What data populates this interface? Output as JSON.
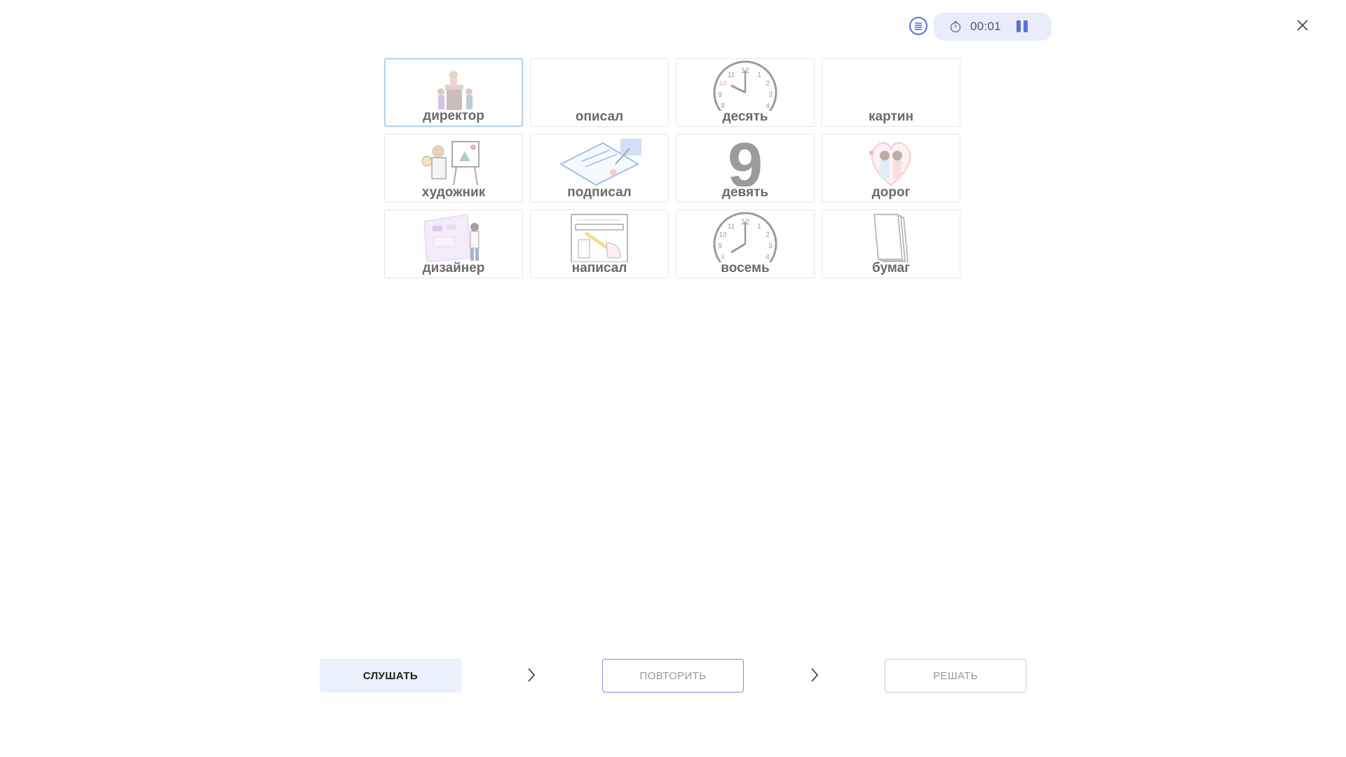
{
  "topbar": {
    "menu_icon": "list-icon",
    "timer_icon": "stopwatch-icon",
    "time": "00:01",
    "pause_icon": "pause-icon",
    "close_icon": "close-icon",
    "accent_color": "#5c6fd6"
  },
  "cards": [
    {
      "label": "директор",
      "picture": "people-on-books-illustration",
      "selected": true
    },
    {
      "label": "описал",
      "picture": "",
      "selected": false
    },
    {
      "label": "десять",
      "picture": "clock-ten-oclock",
      "selected": false
    },
    {
      "label": "картин",
      "picture": "",
      "selected": false
    },
    {
      "label": "художник",
      "picture": "painter-at-easel-illustration",
      "selected": false
    },
    {
      "label": "подписал",
      "picture": "hand-signing-document",
      "selected": false
    },
    {
      "label": "девять",
      "picture": "digit-nine",
      "selected": false
    },
    {
      "label": "дорог",
      "picture": "couple-with-heart",
      "selected": false
    },
    {
      "label": "дизайнер",
      "picture": "designer-at-board-illustration",
      "selected": false
    },
    {
      "label": "написал",
      "picture": "hand-writing-form",
      "selected": false
    },
    {
      "label": "восемь",
      "picture": "clock-eight-oclock",
      "selected": false
    },
    {
      "label": "бумаг",
      "picture": "paper-stack",
      "selected": false
    }
  ],
  "footer": {
    "listen_label": "СЛУШАТЬ",
    "repeat_label": "ПОВТОРИТЬ",
    "solve_label": "РЕШАТЬ",
    "arrow_icon": "chevron-right-icon"
  }
}
